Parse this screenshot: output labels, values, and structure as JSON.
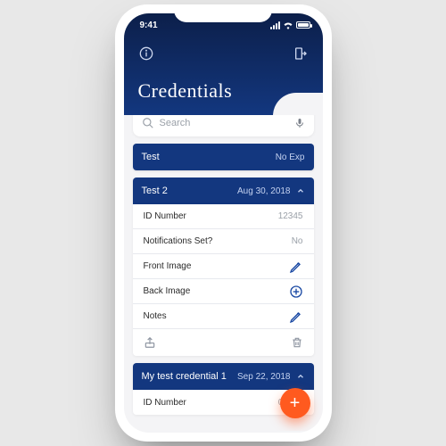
{
  "statusbar": {
    "time": "9:41"
  },
  "header": {
    "title": "Credentials"
  },
  "search": {
    "placeholder": "Search"
  },
  "credentials": [
    {
      "name": "Test",
      "expiry": "No Exp",
      "expanded": false
    },
    {
      "name": "Test 2",
      "expiry": "Aug 30, 2018",
      "expanded": true,
      "details": {
        "id_number_label": "ID Number",
        "id_number_value": "12345",
        "notifications_label": "Notifications Set?",
        "notifications_value": "No",
        "front_image_label": "Front Image",
        "back_image_label": "Back Image",
        "notes_label": "Notes"
      }
    },
    {
      "name": "My test credential 1",
      "expiry": "Sep 22, 2018",
      "expanded": true,
      "details": {
        "id_number_label": "ID Number",
        "id_number_value": "00001"
      }
    }
  ],
  "fab": {
    "label": "+"
  },
  "colors": {
    "brand_dark": "#0c1f4a",
    "brand": "#13377f",
    "accent": "#ff5a1f",
    "icon_blue": "#1948a3"
  }
}
